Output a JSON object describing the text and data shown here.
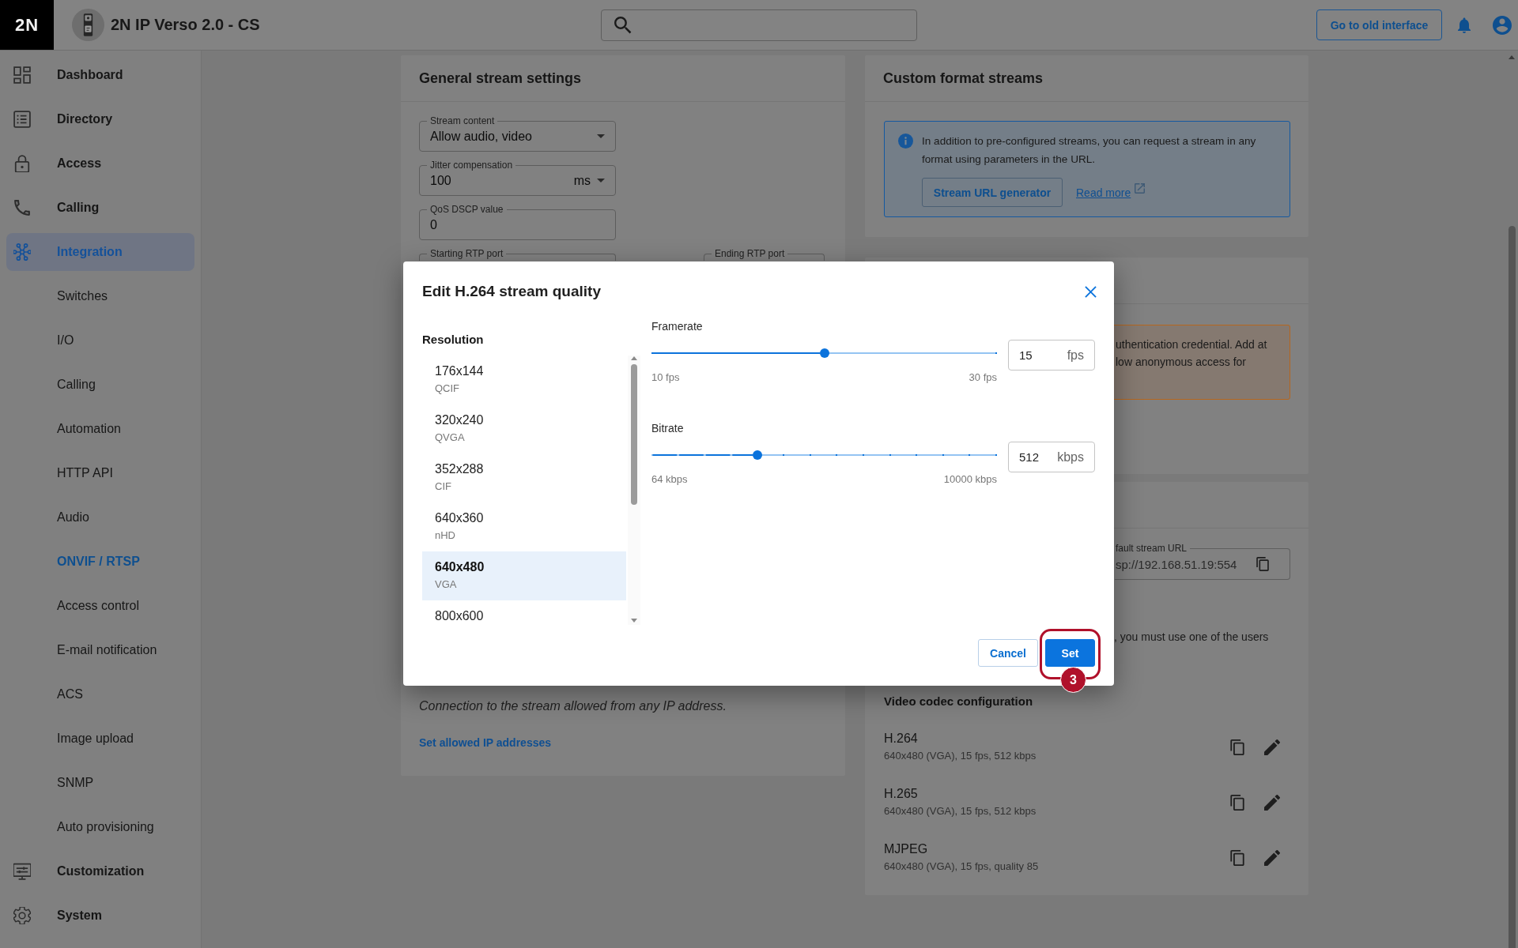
{
  "top_bar": {
    "logo": "2N",
    "title": "2N IP Verso 2.0 - CS",
    "old_interface_button": "Go to old interface"
  },
  "sidebar": {
    "items": [
      {
        "label": "Dashboard",
        "selected": false
      },
      {
        "label": "Directory",
        "selected": false
      },
      {
        "label": "Access",
        "selected": false
      },
      {
        "label": "Calling",
        "selected": false
      },
      {
        "label": "Integration",
        "selected": true,
        "children": [
          {
            "label": "Switches",
            "selected": false
          },
          {
            "label": "I/O",
            "selected": false
          },
          {
            "label": "Calling",
            "selected": false
          },
          {
            "label": "Automation",
            "selected": false
          },
          {
            "label": "HTTP API",
            "selected": false
          },
          {
            "label": "Audio",
            "selected": false
          },
          {
            "label": "ONVIF / RTSP",
            "selected": true
          },
          {
            "label": "Access control",
            "selected": false
          },
          {
            "label": "E-mail notification",
            "selected": false
          },
          {
            "label": "ACS",
            "selected": false
          },
          {
            "label": "Image upload",
            "selected": false
          },
          {
            "label": "SNMP",
            "selected": false
          },
          {
            "label": "Auto provisioning",
            "selected": false
          }
        ]
      },
      {
        "label": "Customization",
        "selected": false
      },
      {
        "label": "System",
        "selected": false
      }
    ]
  },
  "general_stream_settings": {
    "title": "General stream settings",
    "fields": [
      {
        "kind": "select",
        "label": "Stream content",
        "value": "Allow audio, video"
      },
      {
        "kind": "select",
        "label": "Jitter compensation",
        "value": "100",
        "unit": "ms"
      },
      {
        "kind": "text",
        "label": "QoS DSCP value",
        "value": "0"
      }
    ],
    "rtp_ports": [
      {
        "label": "Starting RTP port"
      },
      {
        "label": "Ending RTP port"
      }
    ],
    "ip_note": "Connection to the stream allowed from any IP address.",
    "ip_link": "Set allowed IP addresses"
  },
  "custom_format_streams": {
    "title": "Custom format streams",
    "info": "In addition to pre-configured streams, you can request a stream in any format using parameters in the URL.",
    "generator_button": "Stream URL generator",
    "read_more": "Read more"
  },
  "authentication_card": {
    "warning_lines": [
      "uthentication credential. Add at",
      "low anonymous access for"
    ]
  },
  "streams_card": {
    "url_field": {
      "label": "fault stream URL",
      "value": "sp://192.168.51.19:554"
    },
    "note": ", you must use one of the users",
    "codec_title": "Video codec configuration",
    "codecs": [
      {
        "name": "H.264",
        "details": "640x480 (VGA), 15 fps, 512 kbps"
      },
      {
        "name": "H.265",
        "details": "640x480 (VGA), 15 fps, 512 kbps"
      },
      {
        "name": "MJPEG",
        "details": "640x480 (VGA), 15 fps, quality 85"
      }
    ]
  },
  "dialog": {
    "title": "Edit H.264 stream quality",
    "resolution_label": "Resolution",
    "resolutions": [
      {
        "resolution": "176x144",
        "name": "QCIF",
        "selected": false
      },
      {
        "resolution": "320x240",
        "name": "QVGA",
        "selected": false
      },
      {
        "resolution": "352x288",
        "name": "CIF",
        "selected": false
      },
      {
        "resolution": "640x360",
        "name": "nHD",
        "selected": false
      },
      {
        "resolution": "640x480",
        "name": "VGA",
        "selected": true
      },
      {
        "resolution": "800x600",
        "selected": false
      }
    ],
    "sliders": [
      {
        "kind": "smooth",
        "label": "Framerate",
        "level": 0.5,
        "min_label": "10 fps",
        "max_label": "30 fps",
        "value": "15",
        "unit": "fps"
      },
      {
        "kind": "stepped",
        "label": "Bitrate",
        "level": 0.3077,
        "min_label": "64 kbps",
        "max_label": "10000 kbps",
        "value": "512",
        "unit": "kbps"
      }
    ],
    "buttons": [
      {
        "kind": "secondary",
        "label": "Cancel"
      },
      {
        "kind": "primary",
        "label": "Set",
        "annotation": {
          "step": "3"
        }
      }
    ]
  }
}
